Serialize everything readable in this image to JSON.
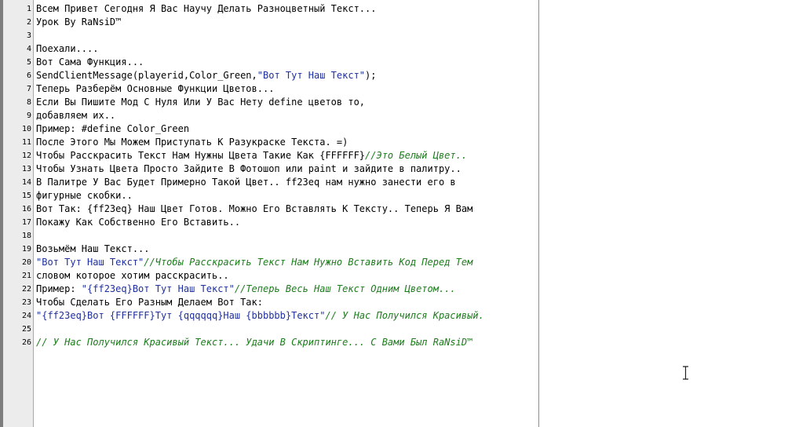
{
  "editor": {
    "lines": [
      {
        "number": "1",
        "segments": [
          {
            "style": "normal",
            "text": "Всем Привет Сегодня Я Вас Научу Делать Разноцветный Текст..."
          }
        ]
      },
      {
        "number": "2",
        "segments": [
          {
            "style": "normal",
            "text": "Урок By RaNsiD™"
          }
        ]
      },
      {
        "number": "3",
        "segments": []
      },
      {
        "number": "4",
        "segments": [
          {
            "style": "normal",
            "text": "Поехали...."
          }
        ]
      },
      {
        "number": "5",
        "segments": [
          {
            "style": "normal",
            "text": "Вот Сама Функция..."
          }
        ]
      },
      {
        "number": "6",
        "segments": [
          {
            "style": "normal",
            "text": "SendClientMessage(playerid,Color_Green,"
          },
          {
            "style": "string",
            "text": "\"Вот Тут Наш Текст\""
          },
          {
            "style": "normal",
            "text": ");"
          }
        ]
      },
      {
        "number": "7",
        "segments": [
          {
            "style": "normal",
            "text": "Теперь Разберём Основные Функции Цветов..."
          }
        ]
      },
      {
        "number": "8",
        "segments": [
          {
            "style": "normal",
            "text": "Если Вы Пишите Мод С Нуля Или У Вас Нету define цветов то,"
          }
        ]
      },
      {
        "number": "9",
        "segments": [
          {
            "style": "normal",
            "text": "добавляем их.."
          }
        ]
      },
      {
        "number": "10",
        "segments": [
          {
            "style": "normal",
            "text": "Пример: #define Color_Green"
          }
        ]
      },
      {
        "number": "11",
        "segments": [
          {
            "style": "normal",
            "text": "После Этого Мы Можем Приступать К Разукраске Текста. =)"
          }
        ]
      },
      {
        "number": "12",
        "segments": [
          {
            "style": "normal",
            "text": "Чтобы Расскрасить Текст Нам Нужны Цвета Такие Как {FFFFFF}"
          },
          {
            "style": "comment",
            "text": "//Это Белый Цвет.."
          }
        ]
      },
      {
        "number": "13",
        "segments": [
          {
            "style": "normal",
            "text": "Чтобы Узнать Цвета Просто Зайдите В Фотошоп или paint и зайдите в палитру.."
          }
        ]
      },
      {
        "number": "14",
        "segments": [
          {
            "style": "normal",
            "text": "В Палитре У Вас Будет Примерно Такой Цвет.. ff23eq нам нужно занести его в"
          }
        ]
      },
      {
        "number": "15",
        "segments": [
          {
            "style": "normal",
            "text": "фигурные скобки.."
          }
        ]
      },
      {
        "number": "16",
        "segments": [
          {
            "style": "normal",
            "text": "Вот Так: {ff23eq} Наш Цвет Готов. Можно Его Вставлять К Тексту.. Теперь Я Вам"
          }
        ]
      },
      {
        "number": "17",
        "segments": [
          {
            "style": "normal",
            "text": "Покажу Как Собственно Его Вставить.."
          }
        ]
      },
      {
        "number": "18",
        "segments": []
      },
      {
        "number": "19",
        "segments": [
          {
            "style": "normal",
            "text": "Возьмём Наш Текст..."
          }
        ]
      },
      {
        "number": "20",
        "segments": [
          {
            "style": "string",
            "text": "\"Вот Тут Наш Текст\""
          },
          {
            "style": "comment",
            "text": "//Чтобы Расскрасить Текст Нам Нужно Вставить Код Перед Тем"
          }
        ]
      },
      {
        "number": "21",
        "segments": [
          {
            "style": "normal",
            "text": "словом которое хотим расскрасить.."
          }
        ]
      },
      {
        "number": "22",
        "segments": [
          {
            "style": "normal",
            "text": "Пример: "
          },
          {
            "style": "string",
            "text": "\"{ff23eq}Вот Тут Наш Текст\""
          },
          {
            "style": "comment",
            "text": "//Теперь Весь Наш Текст Одним Цветом..."
          }
        ]
      },
      {
        "number": "23",
        "segments": [
          {
            "style": "normal",
            "text": "Чтобы Сделать Его Разным Делаем Вот Так:"
          }
        ]
      },
      {
        "number": "24",
        "segments": [
          {
            "style": "string",
            "text": "\"{ff23eq}Вот {FFFFFF}Тут {qqqqqq}Наш {bbbbbb}Текст\""
          },
          {
            "style": "comment",
            "text": "// У Нас Получился Красивый."
          }
        ]
      },
      {
        "number": "25",
        "segments": []
      },
      {
        "number": "26",
        "segments": [
          {
            "style": "comment",
            "text": "// У Нас Получился Красивый Текст... Удачи В Скриптинге... С Вами Был RaNsiD™"
          }
        ]
      }
    ]
  },
  "colors": {
    "normal": "#000000",
    "string": "#1e2f9e",
    "comment": "#1c7c1c",
    "gutter": "#ececec"
  },
  "icons": {
    "cursor": "text-cursor-icon"
  }
}
